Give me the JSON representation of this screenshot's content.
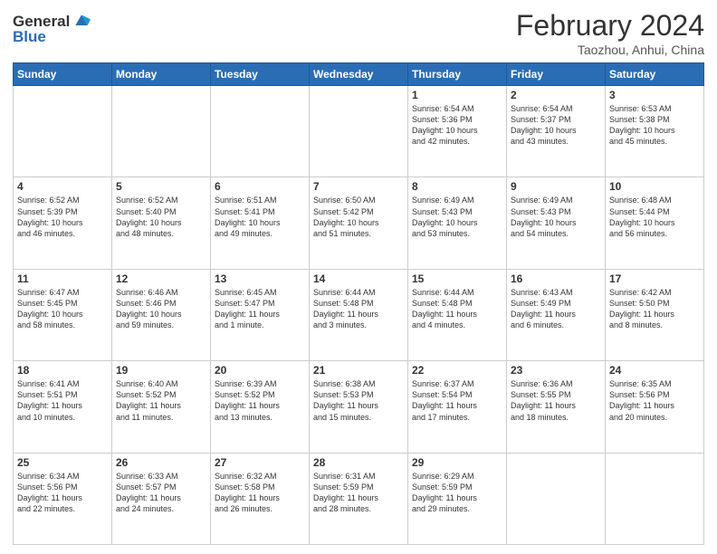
{
  "header": {
    "logo": {
      "line1": "General",
      "line2": "Blue"
    },
    "title": "February 2024",
    "subtitle": "Taozhou, Anhui, China"
  },
  "weekdays": [
    "Sunday",
    "Monday",
    "Tuesday",
    "Wednesday",
    "Thursday",
    "Friday",
    "Saturday"
  ],
  "weeks": [
    [
      {
        "day": "",
        "info": ""
      },
      {
        "day": "",
        "info": ""
      },
      {
        "day": "",
        "info": ""
      },
      {
        "day": "",
        "info": ""
      },
      {
        "day": "1",
        "info": "Sunrise: 6:54 AM\nSunset: 5:36 PM\nDaylight: 10 hours\nand 42 minutes."
      },
      {
        "day": "2",
        "info": "Sunrise: 6:54 AM\nSunset: 5:37 PM\nDaylight: 10 hours\nand 43 minutes."
      },
      {
        "day": "3",
        "info": "Sunrise: 6:53 AM\nSunset: 5:38 PM\nDaylight: 10 hours\nand 45 minutes."
      }
    ],
    [
      {
        "day": "4",
        "info": "Sunrise: 6:52 AM\nSunset: 5:39 PM\nDaylight: 10 hours\nand 46 minutes."
      },
      {
        "day": "5",
        "info": "Sunrise: 6:52 AM\nSunset: 5:40 PM\nDaylight: 10 hours\nand 48 minutes."
      },
      {
        "day": "6",
        "info": "Sunrise: 6:51 AM\nSunset: 5:41 PM\nDaylight: 10 hours\nand 49 minutes."
      },
      {
        "day": "7",
        "info": "Sunrise: 6:50 AM\nSunset: 5:42 PM\nDaylight: 10 hours\nand 51 minutes."
      },
      {
        "day": "8",
        "info": "Sunrise: 6:49 AM\nSunset: 5:43 PM\nDaylight: 10 hours\nand 53 minutes."
      },
      {
        "day": "9",
        "info": "Sunrise: 6:49 AM\nSunset: 5:43 PM\nDaylight: 10 hours\nand 54 minutes."
      },
      {
        "day": "10",
        "info": "Sunrise: 6:48 AM\nSunset: 5:44 PM\nDaylight: 10 hours\nand 56 minutes."
      }
    ],
    [
      {
        "day": "11",
        "info": "Sunrise: 6:47 AM\nSunset: 5:45 PM\nDaylight: 10 hours\nand 58 minutes."
      },
      {
        "day": "12",
        "info": "Sunrise: 6:46 AM\nSunset: 5:46 PM\nDaylight: 10 hours\nand 59 minutes."
      },
      {
        "day": "13",
        "info": "Sunrise: 6:45 AM\nSunset: 5:47 PM\nDaylight: 11 hours\nand 1 minute."
      },
      {
        "day": "14",
        "info": "Sunrise: 6:44 AM\nSunset: 5:48 PM\nDaylight: 11 hours\nand 3 minutes."
      },
      {
        "day": "15",
        "info": "Sunrise: 6:44 AM\nSunset: 5:48 PM\nDaylight: 11 hours\nand 4 minutes."
      },
      {
        "day": "16",
        "info": "Sunrise: 6:43 AM\nSunset: 5:49 PM\nDaylight: 11 hours\nand 6 minutes."
      },
      {
        "day": "17",
        "info": "Sunrise: 6:42 AM\nSunset: 5:50 PM\nDaylight: 11 hours\nand 8 minutes."
      }
    ],
    [
      {
        "day": "18",
        "info": "Sunrise: 6:41 AM\nSunset: 5:51 PM\nDaylight: 11 hours\nand 10 minutes."
      },
      {
        "day": "19",
        "info": "Sunrise: 6:40 AM\nSunset: 5:52 PM\nDaylight: 11 hours\nand 11 minutes."
      },
      {
        "day": "20",
        "info": "Sunrise: 6:39 AM\nSunset: 5:52 PM\nDaylight: 11 hours\nand 13 minutes."
      },
      {
        "day": "21",
        "info": "Sunrise: 6:38 AM\nSunset: 5:53 PM\nDaylight: 11 hours\nand 15 minutes."
      },
      {
        "day": "22",
        "info": "Sunrise: 6:37 AM\nSunset: 5:54 PM\nDaylight: 11 hours\nand 17 minutes."
      },
      {
        "day": "23",
        "info": "Sunrise: 6:36 AM\nSunset: 5:55 PM\nDaylight: 11 hours\nand 18 minutes."
      },
      {
        "day": "24",
        "info": "Sunrise: 6:35 AM\nSunset: 5:56 PM\nDaylight: 11 hours\nand 20 minutes."
      }
    ],
    [
      {
        "day": "25",
        "info": "Sunrise: 6:34 AM\nSunset: 5:56 PM\nDaylight: 11 hours\nand 22 minutes."
      },
      {
        "day": "26",
        "info": "Sunrise: 6:33 AM\nSunset: 5:57 PM\nDaylight: 11 hours\nand 24 minutes."
      },
      {
        "day": "27",
        "info": "Sunrise: 6:32 AM\nSunset: 5:58 PM\nDaylight: 11 hours\nand 26 minutes."
      },
      {
        "day": "28",
        "info": "Sunrise: 6:31 AM\nSunset: 5:59 PM\nDaylight: 11 hours\nand 28 minutes."
      },
      {
        "day": "29",
        "info": "Sunrise: 6:29 AM\nSunset: 5:59 PM\nDaylight: 11 hours\nand 29 minutes."
      },
      {
        "day": "",
        "info": ""
      },
      {
        "day": "",
        "info": ""
      }
    ]
  ]
}
